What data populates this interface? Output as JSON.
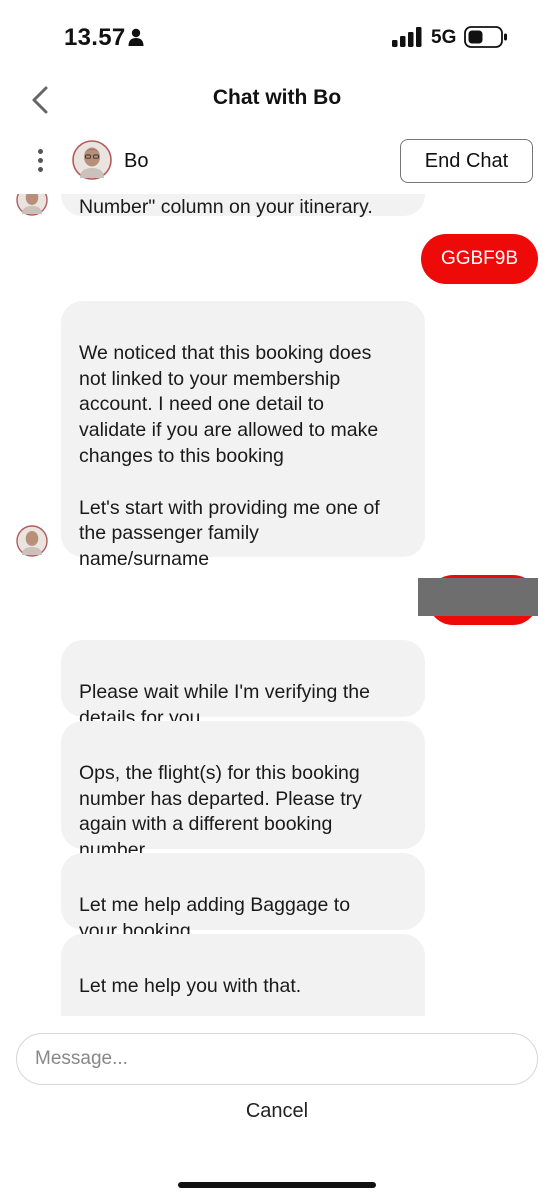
{
  "status_bar": {
    "time": "13.57",
    "network": "5G"
  },
  "nav": {
    "title": "Chat with Bo"
  },
  "agent": {
    "name": "Bo",
    "end_chat_label": "End Chat"
  },
  "messages": [
    {
      "from": "bot",
      "text": "Number\" column on your itinerary."
    },
    {
      "from": "user",
      "text": "GGBF9B"
    },
    {
      "from": "bot",
      "text": "We noticed that this booking does\nnot linked to your membership\naccount. I need one detail to\nvalidate if you are allowed to make\nchanges to this booking\n\nLet's start with providing me one of\nthe passenger family\nname/surname"
    },
    {
      "from": "user",
      "text": ""
    },
    {
      "from": "bot",
      "text": "Please wait while I'm verifying the\ndetails for you."
    },
    {
      "from": "bot",
      "text": "Ops, the flight(s) for this booking\nnumber has departed. Please try\nagain with a different booking\nnumber."
    },
    {
      "from": "bot",
      "text": "Let me help adding Baggage to\nyour booking"
    },
    {
      "from": "bot",
      "text": "Let me help you with that.\n\nI need your booking number or"
    }
  ],
  "composer": {
    "placeholder": "Message...",
    "cancel_label": "Cancel"
  },
  "colors": {
    "user_bubble": "#ef0a0a",
    "bot_bubble": "#f2f2f2"
  }
}
